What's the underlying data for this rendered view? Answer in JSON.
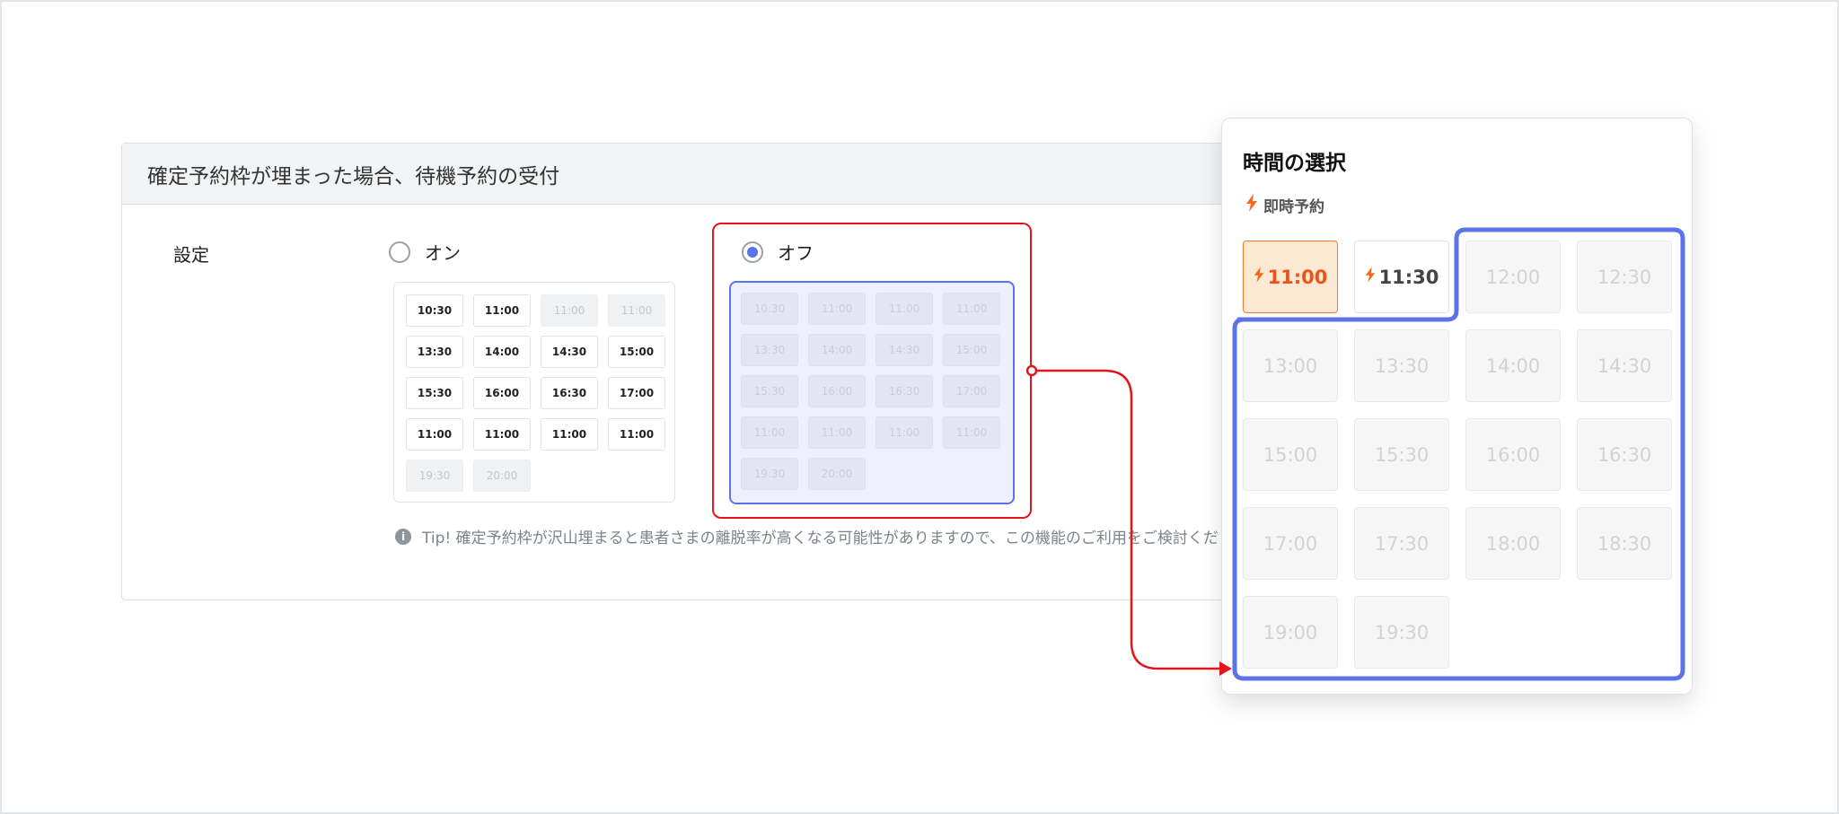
{
  "settings_card": {
    "title": "確定予約枠が埋まった場合、待機予約の受付",
    "label": "設定",
    "options": {
      "on": {
        "label": "オン",
        "selected": false
      },
      "off": {
        "label": "オフ",
        "selected": true
      }
    },
    "on_preview_slots": [
      {
        "time": "10:30",
        "available": true
      },
      {
        "time": "11:00",
        "available": true
      },
      {
        "time": "11:00",
        "available": false
      },
      {
        "time": "11:00",
        "available": false
      },
      {
        "time": "13:30",
        "available": true
      },
      {
        "time": "14:00",
        "available": true
      },
      {
        "time": "14:30",
        "available": true
      },
      {
        "time": "15:00",
        "available": true
      },
      {
        "time": "15:30",
        "available": true
      },
      {
        "time": "16:00",
        "available": true
      },
      {
        "time": "16:30",
        "available": true
      },
      {
        "time": "17:00",
        "available": true
      },
      {
        "time": "11:00",
        "available": true
      },
      {
        "time": "11:00",
        "available": true
      },
      {
        "time": "11:00",
        "available": true
      },
      {
        "time": "11:00",
        "available": true
      },
      {
        "time": "19:30",
        "available": false
      },
      {
        "time": "20:00",
        "available": false
      }
    ],
    "off_preview_slots": [
      "10:30",
      "11:00",
      "11:00",
      "11:00",
      "13:30",
      "14:00",
      "14:30",
      "15:00",
      "15:30",
      "16:00",
      "16:30",
      "17:00",
      "11:00",
      "11:00",
      "11:00",
      "11:00",
      "19:30",
      "20:00"
    ],
    "tip": "Tip! 確定予約枠が沢山埋まると患者さまの離脱率が高くなる可能性がありますので、この機能のご利用をご検討くだ"
  },
  "time_picker": {
    "title": "時間の選択",
    "instant_label": "即時予約",
    "slots": [
      {
        "time": "11:00",
        "type": "instant-selected"
      },
      {
        "time": "11:30",
        "type": "instant"
      },
      {
        "time": "12:00",
        "type": "disabled"
      },
      {
        "time": "12:30",
        "type": "disabled"
      },
      {
        "time": "13:00",
        "type": "disabled"
      },
      {
        "time": "13:30",
        "type": "disabled"
      },
      {
        "time": "14:00",
        "type": "disabled"
      },
      {
        "time": "14:30",
        "type": "disabled"
      },
      {
        "time": "15:00",
        "type": "disabled"
      },
      {
        "time": "15:30",
        "type": "disabled"
      },
      {
        "time": "16:00",
        "type": "disabled"
      },
      {
        "time": "16:30",
        "type": "disabled"
      },
      {
        "time": "17:00",
        "type": "disabled"
      },
      {
        "time": "17:30",
        "type": "disabled"
      },
      {
        "time": "18:00",
        "type": "disabled"
      },
      {
        "time": "18:30",
        "type": "disabled"
      },
      {
        "time": "19:00",
        "type": "disabled"
      },
      {
        "time": "19:30",
        "type": "disabled"
      }
    ]
  },
  "icons": {
    "instant": "lightning-bolt-icon",
    "info": "info-icon"
  },
  "colors": {
    "highlight_red": "#e0161b",
    "highlight_blue": "#5b73e8",
    "instant_orange": "#f26a1b"
  }
}
